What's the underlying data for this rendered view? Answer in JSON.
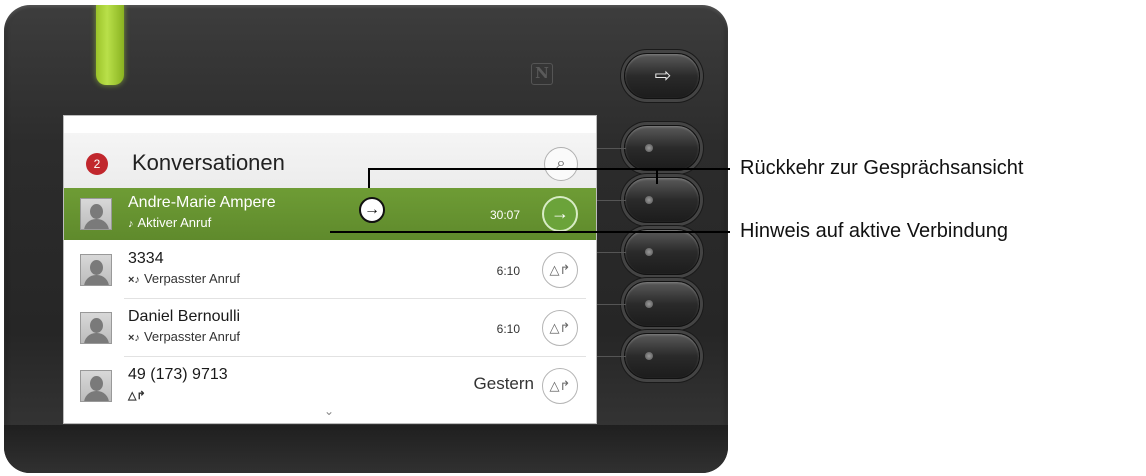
{
  "screen": {
    "badge_count": "2",
    "title": "Konversationen",
    "search_glyph": "⌕"
  },
  "conversations": [
    {
      "name": "Andre-Marie Ampere",
      "status_icon": "♪",
      "status": "Aktiver Anruf",
      "time": "30:07",
      "action_glyph": "→",
      "active": true
    },
    {
      "name": "3334",
      "status_icon": "×♪",
      "status": "Verpasster Anruf",
      "time": "6:10",
      "action_glyph": "△↱",
      "active": false
    },
    {
      "name": "Daniel Bernoulli",
      "status_icon": "×♪",
      "status": "Verpasster Anruf",
      "time": "6:10",
      "action_glyph": "△↱",
      "active": false
    },
    {
      "name": "49 (173) 9713",
      "status_icon": "△↱",
      "status": "",
      "time": "Gestern",
      "action_glyph": "△↱",
      "active": false
    }
  ],
  "active_indicator_glyph": "→",
  "scroll_glyph": "⌄",
  "hardware": {
    "exit_glyph": "⇨",
    "nfc_label": "N"
  },
  "callouts": {
    "return_to_call_view": "Rückkehr zur Gesprächsansicht",
    "active_connection_hint": "Hinweis auf aktive Verbindung"
  },
  "colors": {
    "active_row": "#6e9c35",
    "badge": "#c1272d",
    "led": "#9cc42a"
  }
}
